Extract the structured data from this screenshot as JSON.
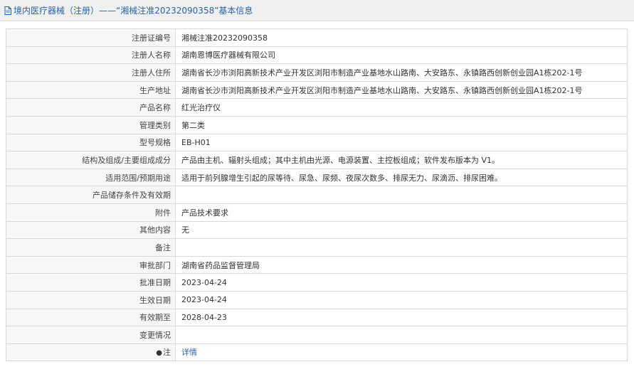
{
  "header": {
    "category": "境内医疗器械（注册）",
    "separator": " —— ",
    "title": "“湘械注准20232090358”基本信息"
  },
  "rows": [
    {
      "label": "注册证编号",
      "value": "湘械注准20232090358"
    },
    {
      "label": "注册人名称",
      "value": "湖南恩博医疗器械有限公司"
    },
    {
      "label": "注册人住所",
      "value": "湖南省长沙市浏阳高新技术产业开发区浏阳市制造产业基地水山路南、大安路东、永镇路西创新创业园A1栋202-1号"
    },
    {
      "label": "生产地址",
      "value": "湖南省长沙市浏阳高新技术产业开发区浏阳市制造产业基地水山路南、大安路东、永镇路西创新创业园A1栋202-1号"
    },
    {
      "label": "产品名称",
      "value": "红光治疗仪"
    },
    {
      "label": "管理类别",
      "value": "第二类"
    },
    {
      "label": "型号规格",
      "value": "EB-H01"
    },
    {
      "label": "结构及组成/主要组成成分",
      "value": "产品由主机、辐射头组成；其中主机由光源、电源装置、主控板组成；软件发布版本为 V1。"
    },
    {
      "label": "适用范围/预期用途",
      "value": "适用于前列腺增生引起的尿等待、尿急、尿频、夜尿次数多、排尿无力、尿滴沥、排尿困难。"
    },
    {
      "label": "产品储存条件及有效期",
      "value": ""
    },
    {
      "label": "附件",
      "value": "产品技术要求"
    },
    {
      "label": "其他内容",
      "value": "无"
    },
    {
      "label": "备注",
      "value": ""
    },
    {
      "label": "审批部门",
      "value": "湖南省药品监督管理局"
    },
    {
      "label": "批准日期",
      "value": "2023-04-24"
    },
    {
      "label": "生效日期",
      "value": "2023-04-24"
    },
    {
      "label": "有效期至",
      "value": "2028-04-23"
    },
    {
      "label": "变更情况",
      "value": ""
    }
  ],
  "note_row": {
    "label": "注",
    "icon": "pin-icon",
    "link_text": "详情"
  },
  "colors": {
    "link": "#2a62a8",
    "label_bg": "#f7f7f7",
    "border": "#d9d9d9",
    "header_bg": "#f0f0f0"
  }
}
